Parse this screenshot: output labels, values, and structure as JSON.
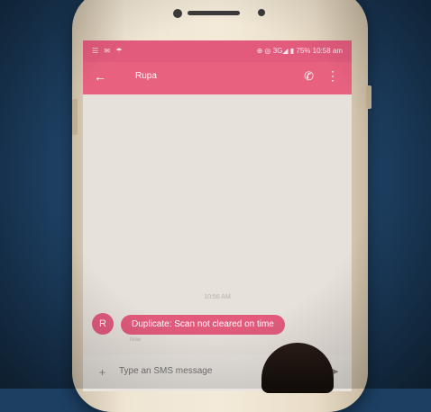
{
  "status_bar": {
    "left_text": "☰ ✉ ☂",
    "right_text": "⊕ ◎ 3G◢ ▮ 75% 10:58 am"
  },
  "header": {
    "back_icon": "←",
    "contact_name": "Rupa",
    "call_icon": "✆",
    "more_icon": "⋮"
  },
  "conversation": {
    "timestamp": "10:56 AM",
    "avatar_letter": "R",
    "message": "Duplicate: Scan not cleared on time",
    "message_sub": "Now"
  },
  "composer": {
    "attach_icon": "+",
    "placeholder": "Type an SMS message",
    "send_icon": "➤"
  },
  "colors": {
    "accent": "#e25b7d",
    "backdrop": "#1d3f62"
  }
}
